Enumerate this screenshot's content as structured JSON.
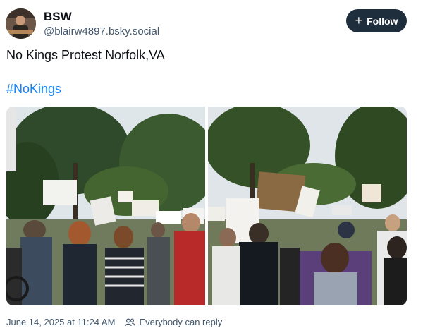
{
  "author": {
    "display_name": "BSW",
    "handle": "@blairw4897.bsky.social"
  },
  "follow_button": {
    "icon": "plus-icon",
    "label": "Follow"
  },
  "post": {
    "text": "No Kings Protest Norfolk,VA",
    "hashtag": "#NoKings"
  },
  "images": [
    {
      "alt_name": "protest-crowd-photo-1"
    },
    {
      "alt_name": "protest-crowd-photo-2"
    }
  ],
  "meta": {
    "timestamp": "June 14, 2025 at 11:24 AM",
    "reply_icon": "people-icon",
    "reply_setting": "Everybody can reply"
  },
  "colors": {
    "follow_bg": "#1f2e3d",
    "link": "#1083fe",
    "secondary_text": "#42576c"
  }
}
